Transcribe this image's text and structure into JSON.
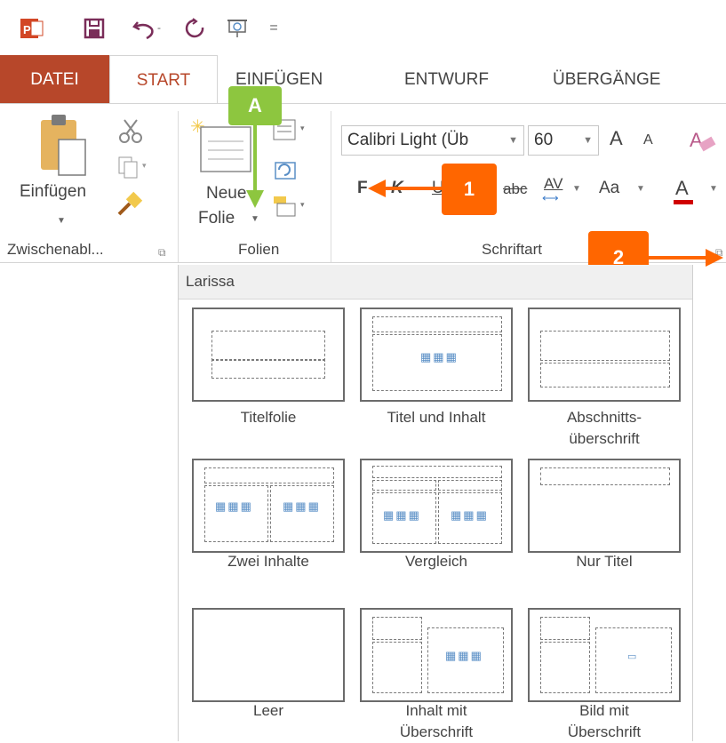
{
  "colors": {
    "accent": "#b7472a",
    "callout_green": "#8dc63f",
    "callout_orange": "#ff6600"
  },
  "qat": {
    "icons": [
      "powerpoint-icon",
      "save-icon",
      "undo-icon",
      "redo-icon",
      "presentation-icon",
      "customize-qat-icon"
    ],
    "more": "="
  },
  "tabs": [
    "DATEI",
    "START",
    "EINFÜGEN",
    "ENTWURF",
    "ÜBERGÄNGE"
  ],
  "ribbon": {
    "clipboard": {
      "paste_label": "Einfügen",
      "group_label": "Zwischenabl..."
    },
    "slides": {
      "new_slide_line1": "Neue",
      "new_slide_line2": "Folie",
      "group_label": "Folien"
    },
    "font": {
      "font_name": "Calibri Light (Üb",
      "font_size": "60",
      "group_label": "Schriftart",
      "bold": "F",
      "kern": "K",
      "underline": "U",
      "strike": "abc",
      "spacing": "AV",
      "case": "Aa",
      "grow": "A",
      "shrink": "A",
      "color": "A"
    }
  },
  "callouts": {
    "a": "A",
    "one": "1",
    "two": "2"
  },
  "gallery": {
    "title": "Larissa",
    "layouts": [
      {
        "line1": "Titelfolie",
        "line2": ""
      },
      {
        "line1": "Titel und Inhalt",
        "line2": ""
      },
      {
        "line1": "Abschnitts-",
        "line2": "überschrift"
      },
      {
        "line1": "Zwei Inhalte",
        "line2": ""
      },
      {
        "line1": "Vergleich",
        "line2": ""
      },
      {
        "line1": "Nur Titel",
        "line2": ""
      },
      {
        "line1": "Leer",
        "line2": ""
      },
      {
        "line1": "Inhalt mit",
        "line2": "Überschrift"
      },
      {
        "line1": "Bild mit",
        "line2": "Überschrift"
      }
    ]
  }
}
